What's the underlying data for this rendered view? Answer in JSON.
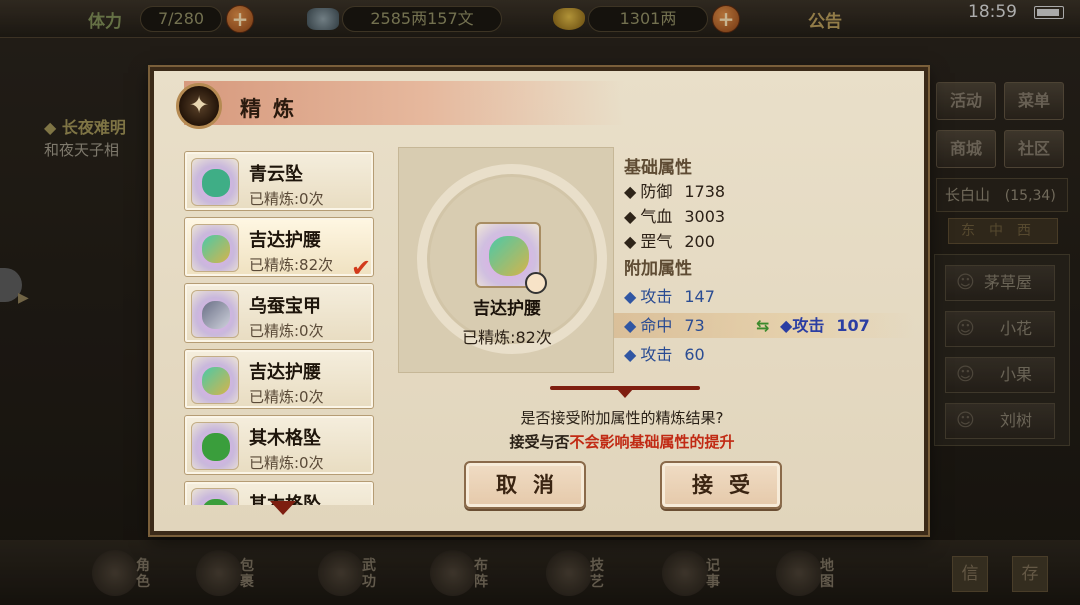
{
  "hud": {
    "stamina_label": "体力",
    "stamina_value": "7/280",
    "silver": "2585两157文",
    "gold": "1301两",
    "notice": "公告",
    "time": "18:59"
  },
  "quest": {
    "title": "◆ 长夜难明",
    "desc": "和夜天子相"
  },
  "right_menu": {
    "activity": "活动",
    "menu": "菜单",
    "mall": "商城",
    "community": "社区",
    "location": "长白山",
    "coords": "(15,34)",
    "compass": "东中西"
  },
  "npcs": [
    "茅草屋",
    "小花",
    "小果",
    "刘树"
  ],
  "bottom_nav": [
    {
      "label": "角色"
    },
    {
      "label": "包裹"
    },
    {
      "label": "武功"
    },
    {
      "label": "布阵"
    },
    {
      "label": "技艺"
    },
    {
      "label": "记事"
    },
    {
      "label": "地图"
    }
  ],
  "bottom_right": [
    "信",
    "存"
  ],
  "dialog": {
    "title": "精炼",
    "items": [
      {
        "name": "青云坠",
        "refined": "已精炼:0次",
        "selected": false,
        "gem_color": "#3fae86"
      },
      {
        "name": "吉达护腰",
        "refined": "已精炼:82次",
        "selected": true,
        "gem_color": "#4bc9a8"
      },
      {
        "name": "乌蚕宝甲",
        "refined": "已精炼:0次",
        "selected": false,
        "gem_color": "#6a6f86"
      },
      {
        "name": "吉达护腰",
        "refined": "已精炼:0次",
        "selected": false,
        "gem_color": "#4bc9a8"
      },
      {
        "name": "其木格坠",
        "refined": "已精炼:0次",
        "selected": false,
        "gem_color": "#3a9e3c"
      },
      {
        "name": "其木格坠",
        "refined": "",
        "selected": false,
        "gem_color": "#3a9e3c"
      }
    ],
    "detail": {
      "name": "吉达护腰",
      "refined": "已精炼:82次"
    },
    "base_title": "基础属性",
    "base_attrs": [
      {
        "name": "防御",
        "value": "1738"
      },
      {
        "name": "气血",
        "value": "3003"
      },
      {
        "name": "罡气",
        "value": "200"
      }
    ],
    "extra_title": "附加属性",
    "extra_attrs": [
      {
        "name": "攻击",
        "value": "147"
      },
      {
        "name": "命中",
        "value": "73",
        "new_name": "攻击",
        "new_value": "107"
      },
      {
        "name": "攻击",
        "value": "60"
      }
    ],
    "question": "是否接受附加属性的精炼结果?",
    "note_prefix": "接受与否",
    "note_red": "不会影响基础属性的提升",
    "cancel": "取消",
    "accept": "接受"
  }
}
